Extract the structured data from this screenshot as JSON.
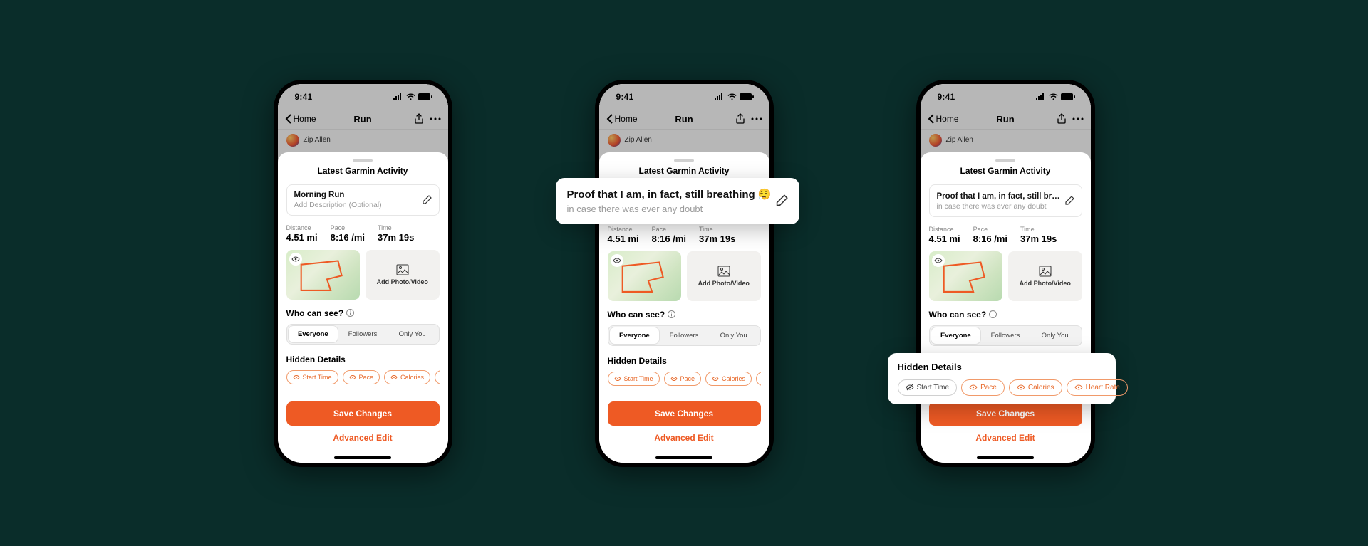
{
  "status": {
    "time": "9:41"
  },
  "nav": {
    "back": "Home",
    "title": "Run"
  },
  "user": {
    "name": "Zip Allen"
  },
  "sheet": {
    "title": "Latest Garmin Activity",
    "activityTitle1": "Morning Run",
    "activityDesc1": "Add Description (Optional)",
    "activityTitle2": "Proof that I am, in fact, still breathing 😮‍💨",
    "activityDesc2": "in case there was ever any doubt",
    "stats": {
      "distLabel": "Distance",
      "distVal": "4.51 mi",
      "paceLabel": "Pace",
      "paceVal": "8:16 /mi",
      "timeLabel": "Time",
      "timeVal": "37m 19s"
    },
    "addPhoto": "Add Photo/Video",
    "privacyTitle": "Who can see?",
    "privacy": {
      "p0": "Everyone",
      "p1": "Followers",
      "p2": "Only You"
    },
    "hiddenTitle": "Hidden Details",
    "chips": {
      "c0": "Start Time",
      "c1": "Pace",
      "c2": "Calories",
      "c3": "Heart Rate",
      "c3short": "Hear"
    },
    "save": "Save Changes",
    "advanced": "Advanced Edit"
  },
  "callout1": {
    "title": "Proof that I am, in fact, still breathing 😮‍💨",
    "sub": "in case there was ever any doubt"
  },
  "callout2": {
    "title": "Hidden Details"
  }
}
